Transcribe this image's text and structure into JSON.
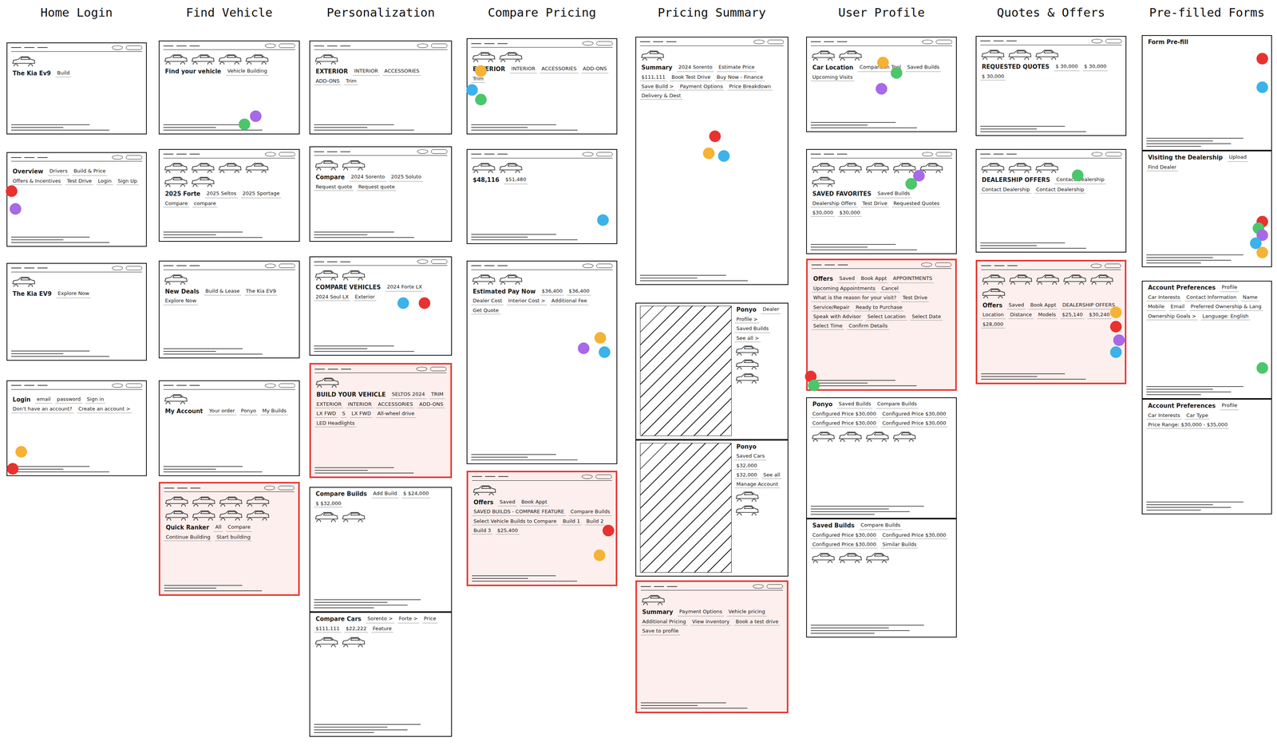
{
  "columns": [
    {
      "title": "Home Login",
      "frames": [
        {
          "kind": "screen",
          "highlighted": false,
          "cars": 1,
          "texts": [
            "The Kia Ev9",
            "Build"
          ],
          "dots": []
        },
        {
          "kind": "screen",
          "highlighted": false,
          "cars": 0,
          "texts": [
            "Overview",
            "Drivers",
            "Build & Price",
            "Offers & Incentives",
            "Test Drive",
            "Login",
            "Sign Up"
          ],
          "dots": [
            {
              "color": "#e8322f"
            },
            {
              "color": "#a769e8"
            }
          ]
        },
        {
          "kind": "screen",
          "highlighted": false,
          "cars": 1,
          "texts": [
            "The Kia EV9",
            "Explore Now"
          ],
          "dots": []
        },
        {
          "kind": "screen",
          "highlighted": false,
          "cars": 0,
          "texts": [
            "Login",
            "email",
            "password",
            "Sign in",
            "Don't have an account?",
            "Create an account >"
          ],
          "dots": [
            {
              "color": "#f5b234"
            },
            {
              "color": "#e8322f"
            }
          ]
        }
      ]
    },
    {
      "title": "Find Vehicle",
      "frames": [
        {
          "kind": "screen",
          "highlighted": false,
          "cars": 4,
          "texts": [
            "Find your vehicle",
            "Vehicle Building"
          ],
          "dots": [
            {
              "color": "#a769e8"
            },
            {
              "color": "#4cc66a"
            }
          ]
        },
        {
          "kind": "screen",
          "highlighted": false,
          "cars": 6,
          "texts": [
            "2025 Forte",
            "2025 Seltos",
            "2025 Sportage",
            "Compare",
            "compare"
          ],
          "dots": []
        },
        {
          "kind": "screen",
          "highlighted": false,
          "cars": 1,
          "texts": [
            "New Deals",
            "Build & Lease",
            "The Kia EV9",
            "Explore Now"
          ],
          "dots": []
        },
        {
          "kind": "screen",
          "highlighted": false,
          "cars": 1,
          "texts": [
            "My Account",
            "Your order",
            "Ponyo",
            "My Builds"
          ],
          "dots": []
        },
        {
          "kind": "screen",
          "highlighted": true,
          "cars": 8,
          "texts": [
            "Quick Ranker",
            "All",
            "Compare",
            "Continue Building",
            "Start building"
          ],
          "dots": []
        }
      ]
    },
    {
      "title": "Personalization",
      "frames": [
        {
          "kind": "screen",
          "highlighted": false,
          "cars": 1,
          "texts": [
            "EXTERIOR",
            "INTERIOR",
            "ACCESSORIES",
            "ADD-ONS",
            "Trim"
          ],
          "dots": []
        },
        {
          "kind": "screen",
          "highlighted": false,
          "cars": 2,
          "texts": [
            "Compare",
            "2024 Sorento",
            "2025 Soluto",
            "Request quote",
            "Request quote"
          ],
          "dots": []
        },
        {
          "kind": "screen",
          "highlighted": false,
          "cars": 2,
          "texts": [
            "COMPARE VEHICLES",
            "2024 Forte LX",
            "2024 Soul LX",
            "Exterior"
          ],
          "dots": [
            {
              "color": "#3bb2ea"
            },
            {
              "color": "#e8322f"
            }
          ]
        },
        {
          "kind": "screen",
          "highlighted": true,
          "cars": 1,
          "texts": [
            "BUILD YOUR VEHICLE",
            "SELTOS 2024",
            "TRIM",
            "EXTERIOR",
            "INTERIOR",
            "ACCESSORIES",
            "ADD-ONS",
            "LX FWD",
            "S",
            "LX FWD",
            "All-wheel drive",
            "LED Headlights"
          ],
          "dots": []
        },
        {
          "kind": "document",
          "highlighted": false,
          "cars": 2,
          "texts": [
            "Compare Builds",
            "Add Build",
            "$ $24,000",
            "$ $32,000"
          ],
          "dots": []
        },
        {
          "kind": "document",
          "highlighted": false,
          "cars": 2,
          "texts": [
            "Compare Cars",
            "Sorento >",
            "Forte >",
            "Price",
            "$111,111",
            "$22,222",
            "Feature"
          ],
          "dots": []
        }
      ]
    },
    {
      "title": "Compare Pricing",
      "frames": [
        {
          "kind": "screen",
          "highlighted": false,
          "cars": 2,
          "texts": [
            "EXTERIOR",
            "INTERIOR",
            "ACCESSORIES",
            "ADD-ONS",
            "Trim"
          ],
          "dots": [
            {
              "color": "#f5b234"
            },
            {
              "color": "#3bb2ea"
            },
            {
              "color": "#4cc66a"
            }
          ]
        },
        {
          "kind": "screen",
          "highlighted": false,
          "cars": 2,
          "texts": [
            "$48,116",
            "$51,480"
          ],
          "dots": [
            {
              "color": "#3bb2ea"
            }
          ]
        },
        {
          "kind": "screen",
          "highlighted": false,
          "cars": 2,
          "texts": [
            "Estimated Pay Now",
            "$36,400",
            "$36,400",
            "Dealer Cost",
            "Interior Cost >",
            "Additional Fee",
            "Get Quote"
          ],
          "dots": [
            {
              "color": "#f5b234"
            },
            {
              "color": "#a769e8"
            },
            {
              "color": "#3bb2ea"
            }
          ]
        },
        {
          "kind": "screen",
          "highlighted": true,
          "cars": 1,
          "texts": [
            "Offers",
            "Saved",
            "Book Appt",
            "SAVED BUILDS - COMPARE FEATURE",
            "Compare Builds",
            "Select Vehicle Builds to Compare",
            "Build 1",
            "Build 2",
            "Build 3",
            "$25,400"
          ],
          "dots": [
            {
              "color": "#e8322f"
            },
            {
              "color": "#f5b234"
            }
          ]
        }
      ]
    },
    {
      "title": "Pricing Summary",
      "frames": [
        {
          "kind": "screen",
          "highlighted": false,
          "cars": 1,
          "texts": [
            "Summary",
            "2024 Sorento",
            "Estimate Price",
            "$111,111",
            "Book Test Drive",
            "Buy Now - Finance",
            "Save Build >",
            "Payment Options",
            "Price Breakdown",
            "Delivery & Dest"
          ],
          "dots": [
            {
              "color": "#e8322f"
            },
            {
              "color": "#f5b234"
            },
            {
              "color": "#3bb2ea"
            }
          ]
        },
        {
          "kind": "hatched",
          "highlighted": false,
          "cars": 3,
          "texts": [
            "Ponyo",
            "Dealer",
            "Profile >",
            "Saved Builds",
            "See all >"
          ],
          "dots": []
        },
        {
          "kind": "hatched",
          "highlighted": false,
          "cars": 2,
          "texts": [
            "Ponyo",
            "Saved Cars",
            "$32,000",
            "$32,000",
            "See all",
            "Manage Account"
          ],
          "dots": []
        },
        {
          "kind": "screen",
          "highlighted": true,
          "cars": 1,
          "texts": [
            "Summary",
            "Payment Options",
            "Vehicle pricing",
            "Additional Pricing",
            "View inventory",
            "Book a test drive",
            "Save to profile"
          ],
          "dots": []
        }
      ]
    },
    {
      "title": "User Profile",
      "frames": [
        {
          "kind": "screen",
          "highlighted": false,
          "cars": 2,
          "texts": [
            "Car Location",
            "Comparison Tool",
            "Saved Builds",
            "Upcoming Visits"
          ],
          "dots": [
            {
              "color": "#f5b234"
            },
            {
              "color": "#4cc66a"
            },
            {
              "color": "#a769e8"
            }
          ]
        },
        {
          "kind": "screen",
          "highlighted": false,
          "cars": 6,
          "texts": [
            "SAVED FAVORITES",
            "Saved Builds",
            "Dealership Offers",
            "Test Drive",
            "Requested Quotes",
            "$30,000",
            "$30,000"
          ],
          "dots": [
            {
              "color": "#a769e8"
            },
            {
              "color": "#4cc66a"
            }
          ]
        },
        {
          "kind": "screen",
          "highlighted": true,
          "cars": 0,
          "texts": [
            "Offers",
            "Saved",
            "Book Appt",
            "APPOINTMENTS",
            "Upcoming Appointments",
            "Cancel",
            "What is the reason for your visit?",
            "Test Drive",
            "Service/Repair",
            "Ready to Purchase",
            "Speak with Advisor",
            "Select Location",
            "Select Date",
            "Select Time",
            "Confirm Details"
          ],
          "dots": [
            {
              "color": "#e8322f"
            },
            {
              "color": "#4cc66a"
            }
          ]
        },
        {
          "kind": "document",
          "highlighted": false,
          "cars": 4,
          "texts": [
            "Ponyo",
            "Saved Builds",
            "Compare Builds",
            "Configured Price $30,000",
            "Configured Price $30,000",
            "Configured Price $30,000",
            "Configured Price $30,000"
          ],
          "dots": []
        },
        {
          "kind": "document",
          "highlighted": false,
          "cars": 3,
          "texts": [
            "Saved Builds",
            "Compare Builds",
            "Configured Price $30,000",
            "Configured Price $30,000",
            "Configured Price $30,000",
            "Similar Builds"
          ],
          "dots": []
        }
      ]
    },
    {
      "title": "Quotes & Offers",
      "frames": [
        {
          "kind": "screen",
          "highlighted": false,
          "cars": 3,
          "texts": [
            "REQUESTED QUOTES",
            "$ 30,000",
            "$ 30,000",
            "$ 30,000"
          ],
          "dots": []
        },
        {
          "kind": "screen",
          "highlighted": false,
          "cars": 3,
          "texts": [
            "DEALERSHIP OFFERS",
            "Contact Dealership",
            "Contact Dealership",
            "Contact Dealership"
          ],
          "dots": [
            {
              "color": "#4cc66a"
            }
          ]
        },
        {
          "kind": "screen",
          "highlighted": true,
          "cars": 6,
          "texts": [
            "Offers",
            "Saved",
            "Book Appt",
            "DEALERSHIP OFFERS",
            "Location",
            "Distance",
            "Models",
            "$25,140",
            "$30,240",
            "$28,000"
          ],
          "dots": [
            {
              "color": "#f5b234"
            },
            {
              "color": "#e8322f"
            },
            {
              "color": "#a769e8"
            },
            {
              "color": "#3bb2ea"
            }
          ]
        }
      ]
    },
    {
      "title": "Pre-filled Forms",
      "frames": [
        {
          "kind": "document",
          "highlighted": false,
          "cars": 0,
          "texts": [
            "Form Pre-fill"
          ],
          "dots": [
            {
              "color": "#e8322f"
            },
            {
              "color": "#3bb2ea"
            }
          ]
        },
        {
          "kind": "document",
          "highlighted": false,
          "cars": 0,
          "texts": [
            "Visiting the Dealership",
            "Upload",
            "Find Dealer"
          ],
          "dots": [
            {
              "color": "#e8322f"
            },
            {
              "color": "#4cc66a"
            },
            {
              "color": "#a769e8"
            },
            {
              "color": "#3bb2ea"
            },
            {
              "color": "#f5b234"
            }
          ]
        },
        {
          "kind": "document",
          "highlighted": false,
          "cars": 0,
          "texts": [
            "Account Preferences",
            "Profile",
            "Car Interests",
            "Contact Information",
            "Name",
            "Mobile",
            "Email",
            "Preferred Ownership & Lang",
            "Ownership Goals >",
            "Language: English"
          ],
          "dots": [
            {
              "color": "#4cc66a"
            }
          ]
        },
        {
          "kind": "document",
          "highlighted": false,
          "cars": 0,
          "texts": [
            "Account Preferences",
            "Profile",
            "Car Interests",
            "Car Type",
            "Price Range: $30,000 - $35,000"
          ],
          "dots": []
        }
      ]
    }
  ]
}
